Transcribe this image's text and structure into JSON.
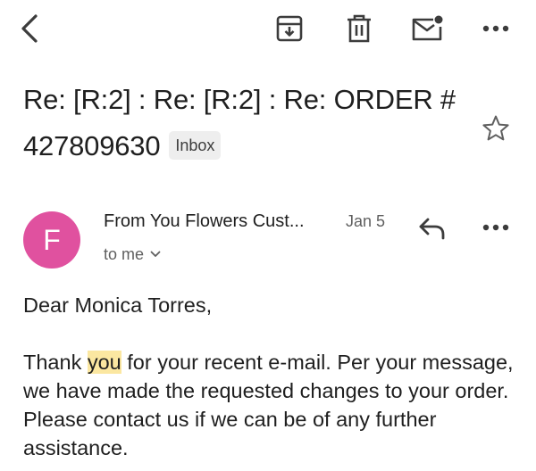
{
  "toolbar": {
    "back_icon": "chevron-left-icon",
    "archive_icon": "archive-icon",
    "delete_icon": "trash-icon",
    "unread_icon": "mark-unread-icon",
    "more_icon": "more-horizontal-icon"
  },
  "email": {
    "subject": "Re: [R:2] : Re: [R:2] : Re: ORDER # 427809630",
    "label": "Inbox",
    "star_icon": "star-outline-icon"
  },
  "message": {
    "avatar_letter": "F",
    "avatar_color": "#e0519f",
    "sender": "From You Flowers Cust...",
    "date": "Jan 5",
    "recipients": "to me",
    "reply_icon": "reply-icon",
    "more_icon": "more-horizontal-icon",
    "greeting": "Dear Monica Torres,",
    "body_before": "Thank ",
    "body_highlight": "you",
    "body_after": " for your recent e-mail. Per your message, we have made the requested changes to your order. Please contact us if we can be of any further assistance.",
    "highlight_color": "#fbe7a1"
  }
}
